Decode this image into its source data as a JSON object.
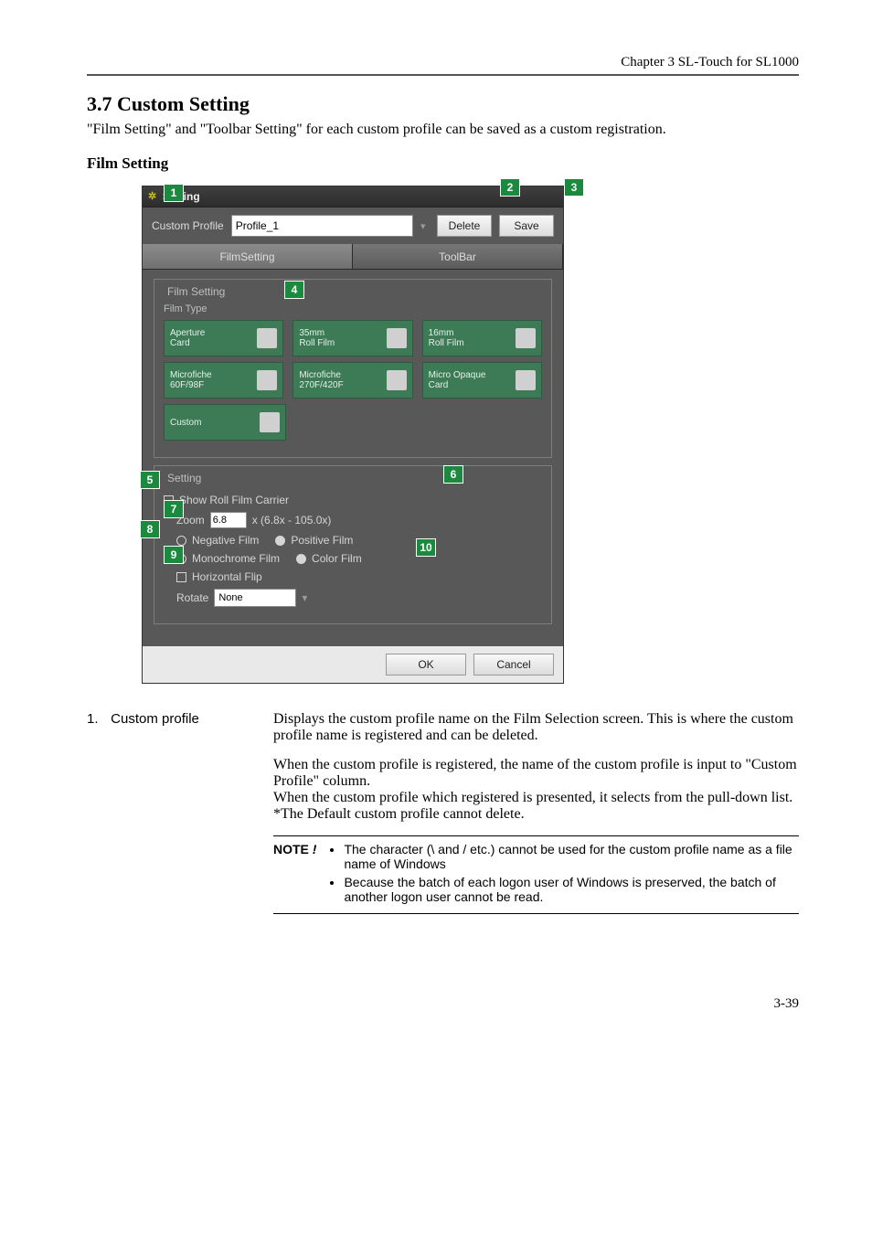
{
  "header": {
    "chapter": "Chapter 3  SL-Touch for SL1000"
  },
  "section": {
    "number_title": "3.7   Custom Setting",
    "intro": "\"Film Setting\" and \"Toolbar Setting\" for each custom profile can be saved as a custom registration.",
    "subhead": "Film Setting"
  },
  "dialog": {
    "title": "Setting",
    "custom_profile_label": "Custom Profile",
    "custom_profile_value": "Profile_1",
    "delete_btn": "Delete",
    "save_btn": "Save",
    "tabs": {
      "film": "FilmSetting",
      "toolbar": "ToolBar"
    },
    "fieldset_film_setting": "Film Setting",
    "fieldset_film_type": "Film Type",
    "film_buttons": {
      "aperture": "Aperture\nCard",
      "roll35": "35mm\nRoll Film",
      "roll16": "16mm\nRoll Film",
      "mf60": "Microfiche\n60F/98F",
      "mf270": "Microfiche\n270F/420F",
      "micro_opaque": "Micro Opaque\nCard",
      "custom": "Custom"
    },
    "fieldset_setting": "Setting",
    "show_roll": "Show Roll Film Carrier",
    "zoom_label": "Zoom",
    "zoom_value": "6.8",
    "zoom_range": "x (6.8x - 105.0x)",
    "neg_film": "Negative Film",
    "pos_film": "Positive Film",
    "mono_film": "Monochrome Film",
    "color_film": "Color Film",
    "hflip": "Horizontal Flip",
    "rotate_label": "Rotate",
    "rotate_value": "None",
    "ok": "OK",
    "cancel": "Cancel"
  },
  "callouts": {
    "c1": "1",
    "c2": "2",
    "c3": "3",
    "c4": "4",
    "c5": "5",
    "c6": "6",
    "c7": "7",
    "c8": "8",
    "c9": "9",
    "c10": "10"
  },
  "desc": {
    "item_no": "1.",
    "item_name": "Custom profile",
    "p1": "Displays the custom profile name on the Film Selection screen. This is where the custom profile name is registered and can be deleted.",
    "p2": "When the custom profile is registered, the name of the custom profile is input to \"Custom Profile\" column.",
    "p3": "When the custom profile which registered is presented, it selects from the pull-down list.",
    "p4": "*The Default custom profile cannot delete."
  },
  "note": {
    "label": "NOTE ",
    "excl": "!",
    "b1": "The character (\\ and / etc.) cannot be used for the custom profile name as a file name of Windows",
    "b2": "Because the batch of each logon user of Windows is preserved, the batch of another logon user cannot be read."
  },
  "footer": {
    "page": "3-39"
  }
}
